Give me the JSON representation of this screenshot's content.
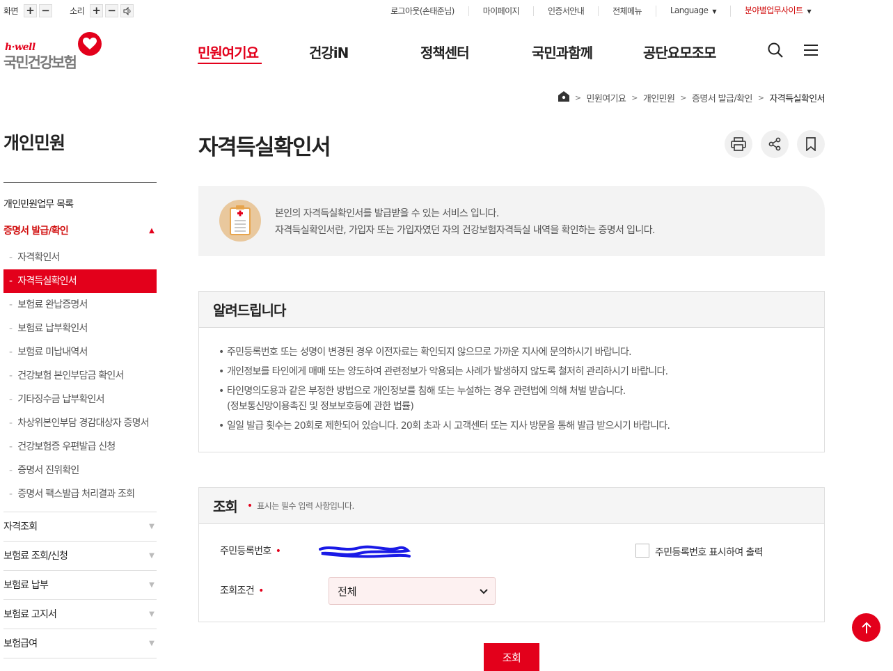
{
  "utility": {
    "screen_label": "화면",
    "sound_label": "소리",
    "plus": "+",
    "minus": "−",
    "links": [
      "로그아웃(손태준님)",
      "마이페이지",
      "인증서안내",
      "전체메뉴"
    ],
    "language": "Language",
    "site_link": "분야별업무사이트"
  },
  "logo": {
    "tagline": "h·well",
    "name": "국민건강보험"
  },
  "gnb": [
    "민원여기요",
    "건강iN",
    "정책센터",
    "국민과함께",
    "공단요모조모"
  ],
  "breadcrumb": [
    "민원여기요",
    "개인민원",
    "증명서 발급/확인",
    "자격득실확인서"
  ],
  "sidebar": {
    "title": "개인민원",
    "top_item": "개인민원업무 목록",
    "open_group": "증명서 발급/확인",
    "sub_items": [
      "자격확인서",
      "자격득실확인서",
      "보험료 완납증명서",
      "보험료 납부확인서",
      "보험료 미납내역서",
      "건강보험 본인부담금 확인서",
      "기타징수금 납부확인서",
      "차상위본인부담 경감대상자 증명서",
      "건강보험증 우편발급 신청",
      "증명서 진위확인",
      "증명서 팩스발급 처리결과 조회"
    ],
    "active_sub": "자격득실확인서",
    "groups": [
      "자격조회",
      "보험료 조회/신청",
      "보험료 납부",
      "보험료 고지서",
      "보험급여"
    ]
  },
  "page": {
    "title": "자격득실확인서",
    "intro_line1": "본인의 자격득실확인서를 발급받을 수 있는 서비스 입니다.",
    "intro_line2": "자격득실확인서란, 가입자 또는 가입자였던 자의 건강보험자격득실 내역을 확인하는 증명서 입니다."
  },
  "notice": {
    "title": "알려드립니다",
    "items": [
      "주민등록번호 또는 성명이 변경된 경우 이전자료는 확인되지 않으므로 가까운 지사에 문의하시기 바랍니다.",
      "개인정보를 타인에게 매매 또는 양도하여 관련정보가 악용되는 사례가 발생하지 않도록 철저히 관리하시기 바랍니다.",
      "타인명의도용과 같은 부정한 방법으로 개인정보를 침해 또는 누설하는 경우 관련법에 의해 처벌 받습니다.",
      "(정보통신망이용촉진 및 정보보호등에 관한 법률)",
      "일일 발급 횟수는 20회로 제한되어 있습니다. 20회 초과 시 고객센터 또는 지사 방문을 통해 발급 받으시기 바랍니다."
    ]
  },
  "query": {
    "title": "조회",
    "required_note": "표시는 필수 입력 사항입니다.",
    "rrn_label": "주민등록번호",
    "rrn_checkbox_label": "주민등록번호 표시하여 출력",
    "condition_label": "조회조건",
    "condition_value": "전체",
    "submit": "조회"
  },
  "colors": {
    "accent": "#e3001b"
  }
}
